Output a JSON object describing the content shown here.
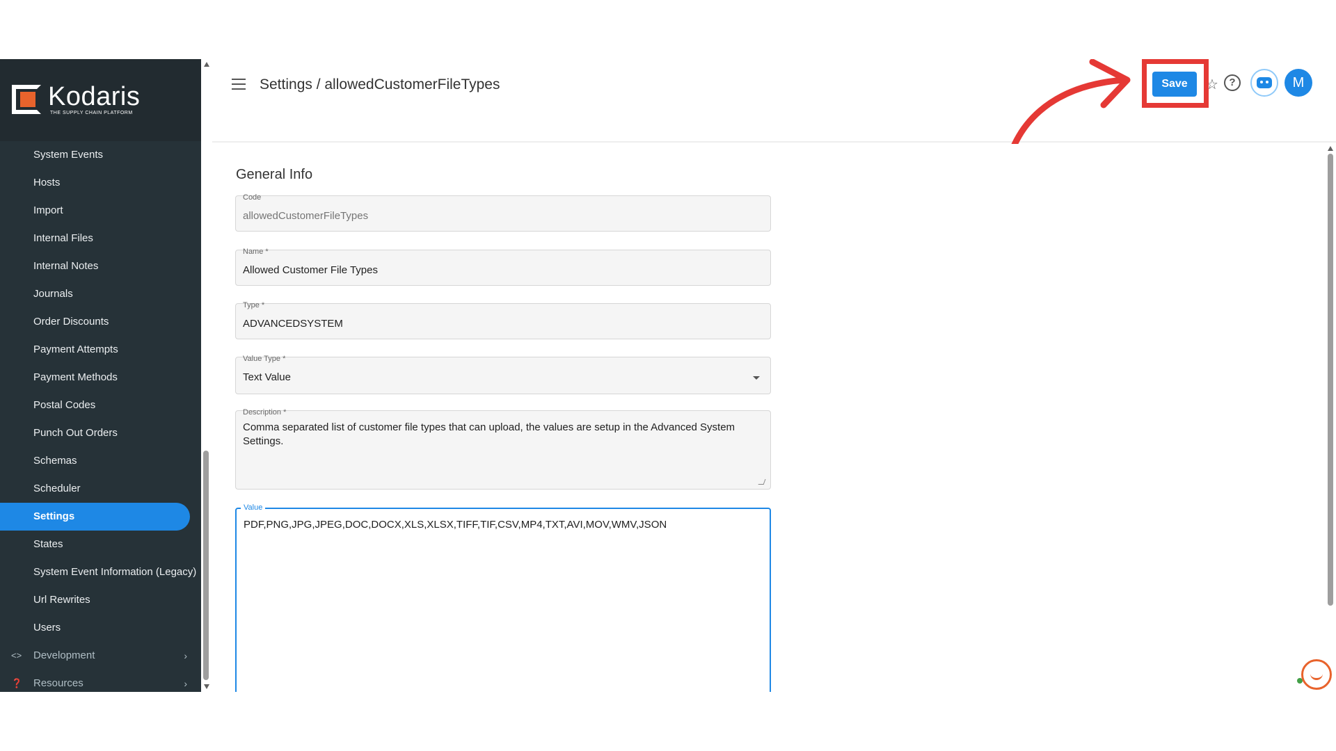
{
  "brand": {
    "name": "Kodaris",
    "tagline": "THE SUPPLY CHAIN PLATFORM",
    "accent": "#e8632c"
  },
  "sidebar": {
    "items": [
      {
        "label": "System Events"
      },
      {
        "label": "Hosts"
      },
      {
        "label": "Import"
      },
      {
        "label": "Internal Files"
      },
      {
        "label": "Internal Notes"
      },
      {
        "label": "Journals"
      },
      {
        "label": "Order Discounts"
      },
      {
        "label": "Payment Attempts"
      },
      {
        "label": "Payment Methods"
      },
      {
        "label": "Postal Codes"
      },
      {
        "label": "Punch Out Orders"
      },
      {
        "label": "Schemas"
      },
      {
        "label": "Scheduler"
      },
      {
        "label": "Settings",
        "active": true
      },
      {
        "label": "States"
      },
      {
        "label": "System Event Information (Legacy)"
      },
      {
        "label": "Url Rewrites"
      },
      {
        "label": "Users"
      }
    ],
    "groups": [
      {
        "label": "Development",
        "icon": "code-icon"
      },
      {
        "label": "Resources",
        "icon": "help-circle-icon"
      }
    ],
    "active_color": "#1e88e5",
    "bg_color": "#263238"
  },
  "header": {
    "title": "Settings / allowedCustomerFileTypes",
    "save_label": "Save",
    "avatar_initial": "M"
  },
  "form": {
    "section_title": "General Info",
    "code": {
      "label": "Code",
      "value": "allowedCustomerFileTypes"
    },
    "name": {
      "label": "Name *",
      "value": "Allowed Customer File Types"
    },
    "type": {
      "label": "Type *",
      "value": "ADVANCEDSYSTEM"
    },
    "value_type": {
      "label": "Value Type *",
      "value": "Text Value"
    },
    "description": {
      "label": "Description *",
      "value": "Comma separated list of customer file types that can upload, the values are setup in the Advanced System Settings."
    },
    "value": {
      "label": "Value",
      "value": "PDF,PNG,JPG,JPEG,DOC,DOCX,XLS,XLSX,TIFF,TIF,CSV,MP4,TXT,AVI,MOV,WMV,JSON"
    }
  },
  "annotation": {
    "highlight_color": "#e53935"
  }
}
